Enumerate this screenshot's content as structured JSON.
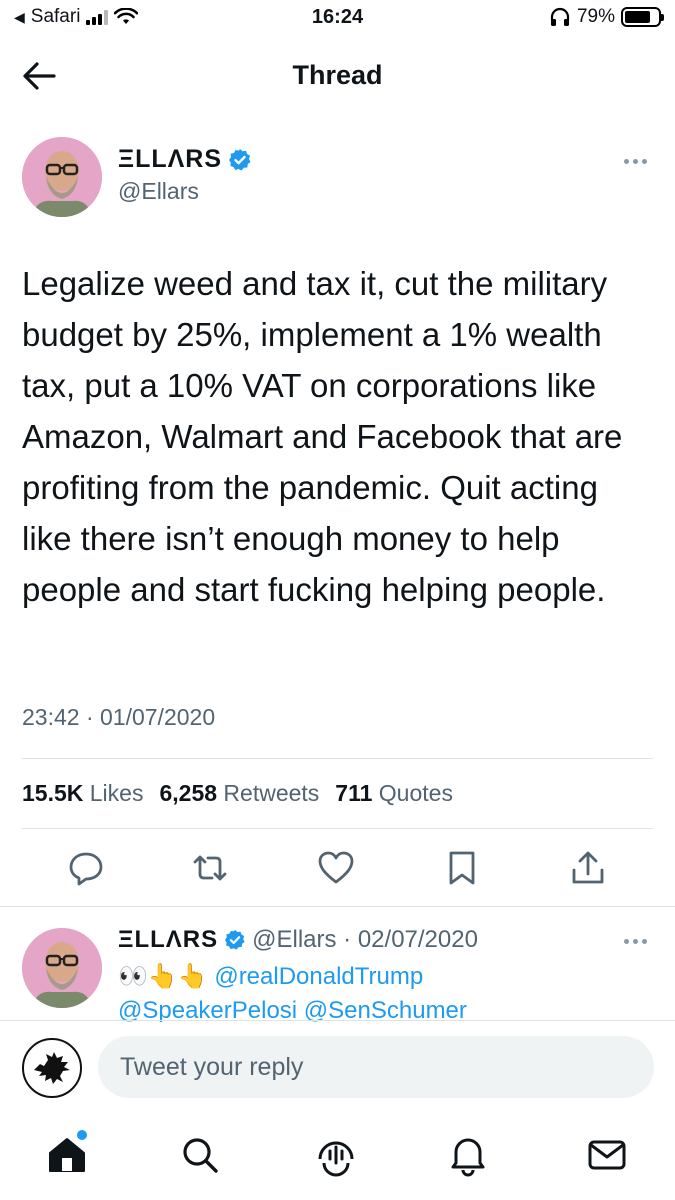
{
  "status_bar": {
    "back_app": "Safari",
    "time": "16:24",
    "battery": "79%",
    "battery_level": 0.79
  },
  "header": {
    "title": "Thread"
  },
  "main_tweet": {
    "name": "ΞLLΛRS",
    "handle": "@Ellars",
    "text": "Legalize weed and tax it, cut the military budget by 25%, implement a 1% wealth tax, put a 10% VAT on corporations like Amazon, Walmart and Facebook that are profiting from the pandemic. Quit acting like there isn’t enough money to help people and start fucking helping people.",
    "timestamp": "23:42 · 01/07/2020",
    "stats": {
      "likes_count": "15.5K",
      "likes_label": "Likes",
      "retweets_count": "6,258",
      "retweets_label": "Retweets",
      "quotes_count": "711",
      "quotes_label": "Quotes"
    }
  },
  "reply_tweet": {
    "name": "ΞLLΛRS",
    "meta": "@Ellars · 02/07/2020",
    "emoji": "👀👆👆",
    "mention_1": "@realDonaldTrump",
    "mention_2": "@SpeakerPelosi",
    "mention_3": "@SenSchumer"
  },
  "composer": {
    "placeholder": "Tweet your reply"
  },
  "colors": {
    "accent": "#1d9bf0",
    "secondary_text": "#536471",
    "avatar_bg": "#e4a5c7"
  }
}
